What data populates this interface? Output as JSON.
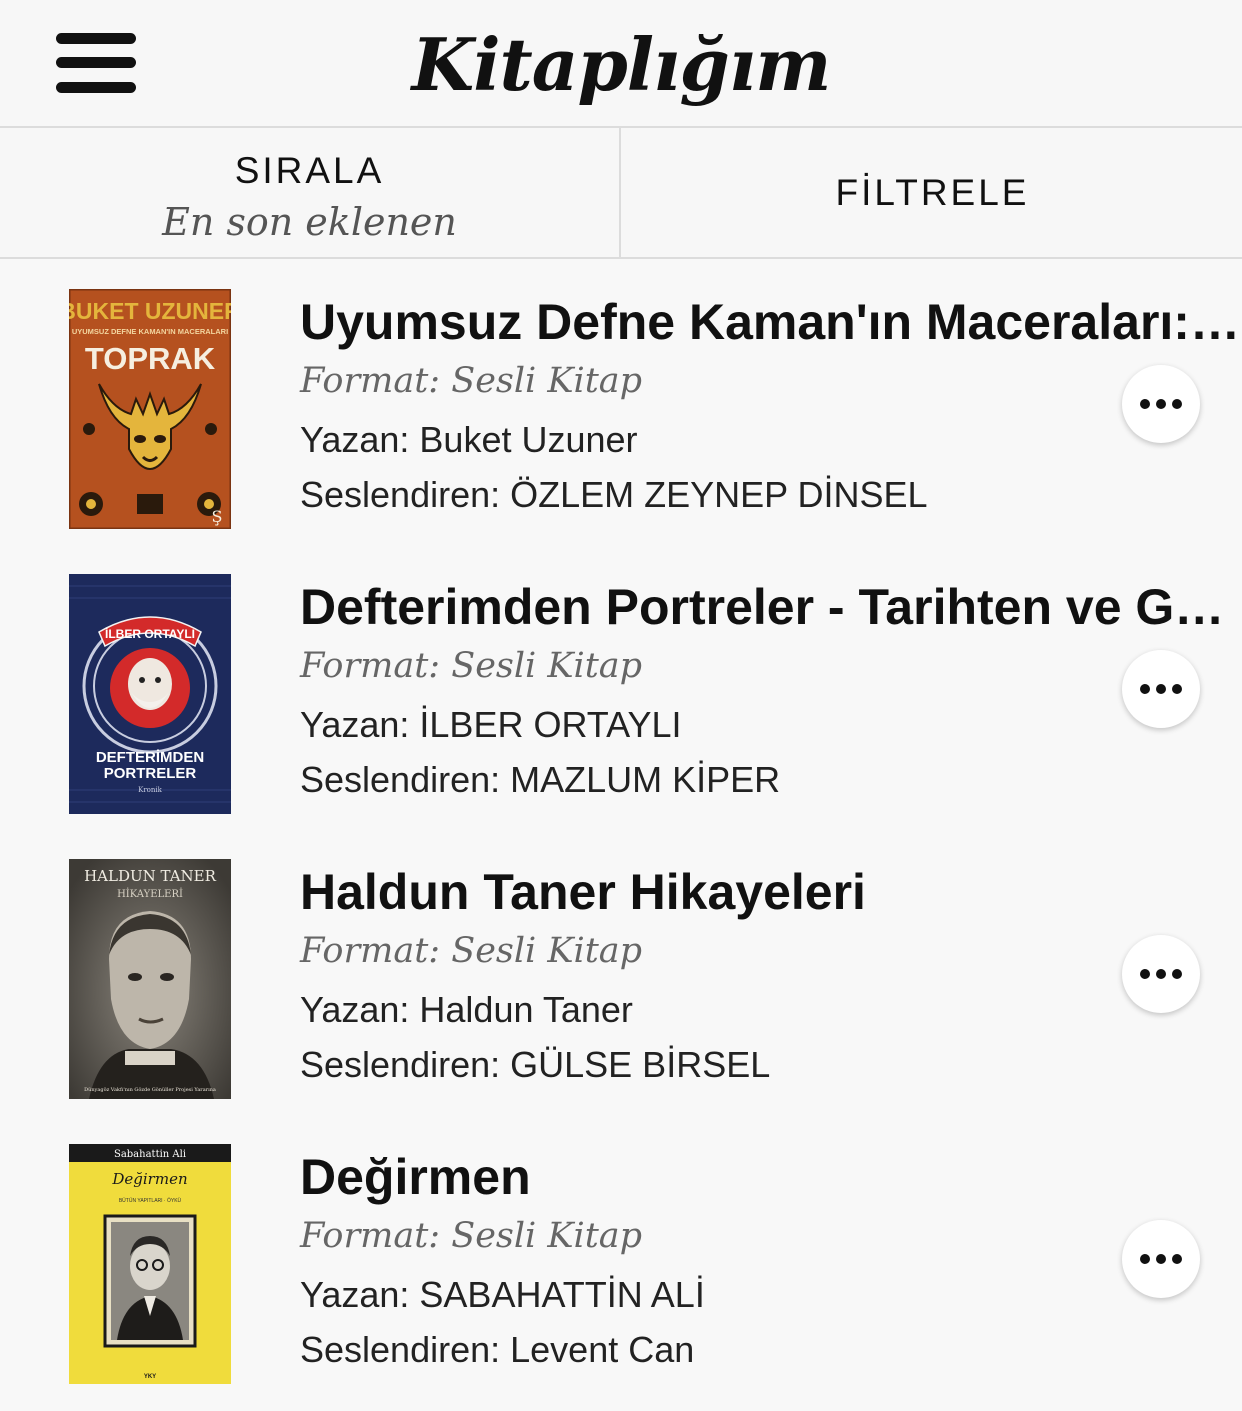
{
  "header": {
    "title": "Kitaplığım",
    "menu_icon": "hamburger-menu-icon"
  },
  "controls": {
    "sort_label": "SIRALA",
    "sort_value": "En son eklenen",
    "filter_label": "FİLTRELE"
  },
  "books": [
    {
      "title": "Uyumsuz Defne Kaman'ın Maceraları: Toprak",
      "format": "Format: Sesli Kitap",
      "author": "Yazan: Buket Uzuner",
      "narrator": "Seslendiren: ÖZLEM ZEYNEP DİNSEL",
      "cover": {
        "line1": "BUKET UZUNER",
        "line2": "UYUMSUZ DEFNE KAMAN'IN MACERALARI",
        "line3": "TOPRAK",
        "mark": "Ş",
        "bg": "#b5511f",
        "accent": "#e4b53c"
      }
    },
    {
      "title": "Defterimden Portreler - Tarihten ve Günümüzden",
      "format": "Format: Sesli Kitap",
      "author": "Yazan: İLBER ORTAYLI",
      "narrator": "Seslendiren: MAZLUM KİPER",
      "cover": {
        "line1": "İLBER ORTAYLI",
        "line2": "DEFTERİMDEN",
        "line3": "PORTRELER",
        "mark": "Kronik",
        "bg": "#1d2a5c",
        "accent": "#d32a2a"
      }
    },
    {
      "title": "Haldun Taner Hikayeleri",
      "format": "Format: Sesli Kitap",
      "author": "Yazan: Haldun Taner",
      "narrator": "Seslendiren: GÜLSE BİRSEL",
      "cover": {
        "line1": "HALDUN TANER",
        "line2": "HİKAYELERİ",
        "line3": "Dünyagöz Vakfı'nın Gözde Gönüller Projesi Yararına",
        "bg": "#4a4640",
        "accent": "#e7e2d6"
      }
    },
    {
      "title": "Değirmen",
      "format": "Format: Sesli Kitap",
      "author": "Yazan: SABAHATTİN ALİ",
      "narrator": "Seslendiren: Levent Can",
      "cover": {
        "line1": "Sabahattin Ali",
        "line2": "Değirmen",
        "line3": "BÜTÜN YAPITLARI · ÖYKÜ",
        "mark": "YKY",
        "bg": "#f0dc3c",
        "accent": "#1a1a1a"
      }
    }
  ],
  "more_icon": "more-options-icon"
}
